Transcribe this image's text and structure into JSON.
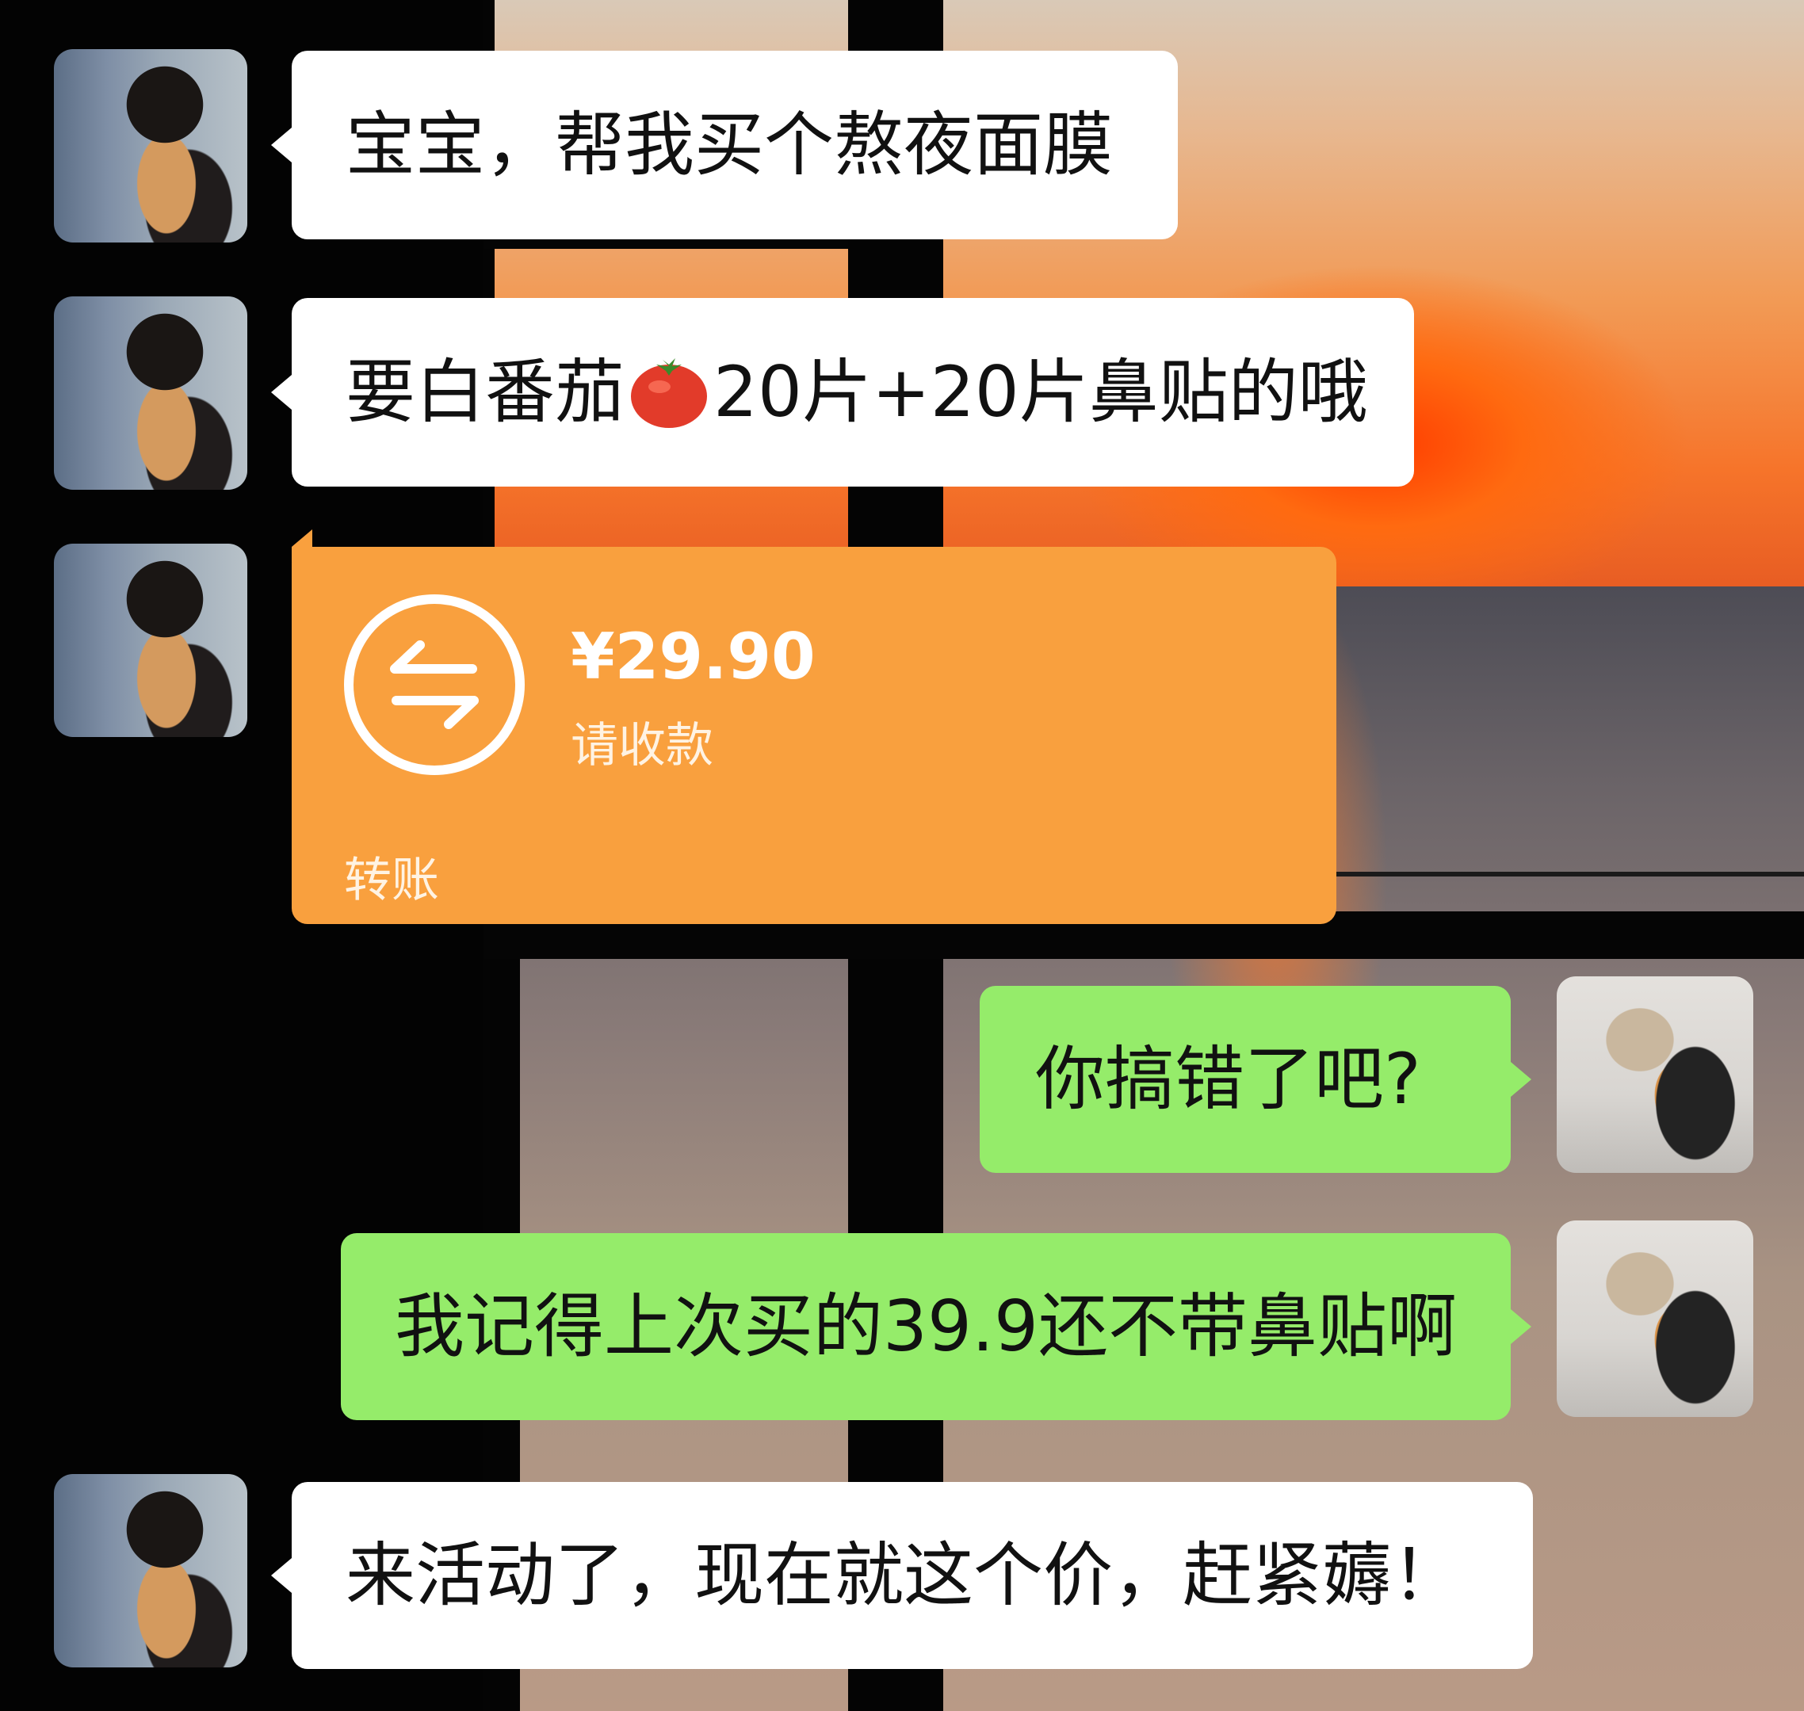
{
  "messages": [
    {
      "sender": "her",
      "type": "text",
      "text": "宝宝，帮我买个熬夜面膜"
    },
    {
      "sender": "her",
      "type": "text",
      "text_before": "要白番茄",
      "emoji": "tomato",
      "text_after": "20片+20片鼻贴的哦"
    },
    {
      "sender": "her",
      "type": "transfer",
      "amount": "¥29.90",
      "note": "请收款",
      "label": "转账"
    },
    {
      "sender": "me",
      "type": "text",
      "text": "你搞错了吧?"
    },
    {
      "sender": "me",
      "type": "text",
      "text": "我记得上次买的39.9还不带鼻贴啊"
    },
    {
      "sender": "her",
      "type": "text",
      "text": "来活动了，现在就这个价，赶紧薅！"
    }
  ],
  "colors": {
    "incoming_bubble": "#ffffff",
    "outgoing_bubble": "#95ec6a",
    "transfer_bubble": "#f9a03e"
  },
  "icons": {
    "transfer": "transfer-arrows-icon",
    "emoji": "tomato-emoji-icon"
  }
}
